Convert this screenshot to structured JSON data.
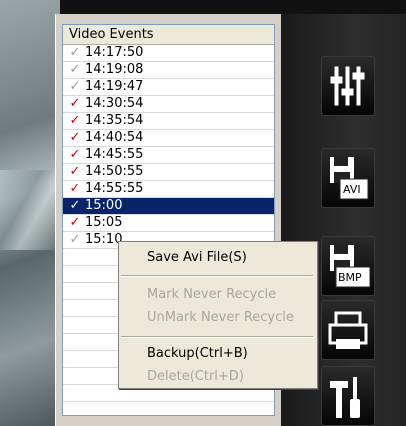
{
  "list": {
    "header": "Video Events",
    "rows": [
      {
        "time": "14:17:50",
        "checked": false
      },
      {
        "time": "14:19:08",
        "checked": false
      },
      {
        "time": "14:19:47",
        "checked": false
      },
      {
        "time": "14:30:54",
        "checked": true
      },
      {
        "time": "14:35:54",
        "checked": true
      },
      {
        "time": "14:40:54",
        "checked": true
      },
      {
        "time": "14:45:55",
        "checked": true
      },
      {
        "time": "14:50:55",
        "checked": true
      },
      {
        "time": "14:55:55",
        "checked": true
      },
      {
        "time": "15:00",
        "checked": false,
        "selected": true
      },
      {
        "time": "15:05",
        "checked": true
      },
      {
        "time": "15:10",
        "checked": false
      }
    ],
    "check_glyph": "✓"
  },
  "context_menu": {
    "save_avi": "Save Avi File(S)",
    "mark_never_recycle": "Mark Never Recycle",
    "unmark_never_recycle": "UnMark Never Recycle",
    "backup": "Backup(Ctrl+B)",
    "delete": "Delete(Ctrl+D)"
  },
  "toolbar": {
    "avi_label": "AVI",
    "bmp_label": "BMP",
    "icons": [
      "sliders-icon",
      "save-avi-icon",
      "save-bmp-icon",
      "print-icon",
      "tools-icon"
    ]
  },
  "colors": {
    "checked": "#d00000",
    "unchecked": "#9a9a9a",
    "selection": "#0a246a",
    "menu_bg": "#ece9d8",
    "disabled_text": "#a9a69b"
  }
}
